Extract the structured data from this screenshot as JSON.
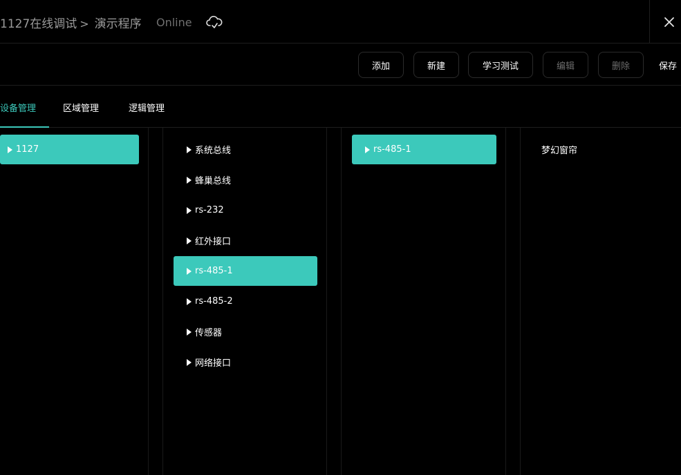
{
  "header": {
    "breadcrumb_root": "1127在线调试",
    "breadcrumb_sep": ">",
    "breadcrumb_page": "演示程序",
    "status": "Online",
    "status_icon": "cloud-sync-icon",
    "close_icon": "close-icon"
  },
  "toolbar": {
    "add_label": "添加",
    "new_label": "新建",
    "learn_test_label": "学习测试",
    "edit_label": "编辑",
    "delete_label": "删除",
    "save_label": "保存"
  },
  "tabs": [
    {
      "label": "设备管理",
      "active": true
    },
    {
      "label": "区域管理",
      "active": false
    },
    {
      "label": "逻辑管理",
      "active": false
    }
  ],
  "columns": {
    "hosts": [
      {
        "label": "1127",
        "selected": true
      }
    ],
    "interfaces": [
      {
        "label": "系统总线",
        "selected": false
      },
      {
        "label": "蜂巢总线",
        "selected": false
      },
      {
        "label": "rs-232",
        "selected": false
      },
      {
        "label": "红外接口",
        "selected": false
      },
      {
        "label": "rs-485-1",
        "selected": true
      },
      {
        "label": "rs-485-2",
        "selected": false
      },
      {
        "label": "传感器",
        "selected": false
      },
      {
        "label": "网络接口",
        "selected": false
      }
    ],
    "ports": [
      {
        "label": "rs-485-1",
        "selected": true
      }
    ],
    "devices": [
      {
        "label": "梦幻窗帘",
        "selected": false
      }
    ]
  },
  "colors": {
    "accent": "#3cc9bb",
    "background": "#000000",
    "muted_text": "#9a9a9a",
    "disabled_text": "#6c6c6c"
  }
}
